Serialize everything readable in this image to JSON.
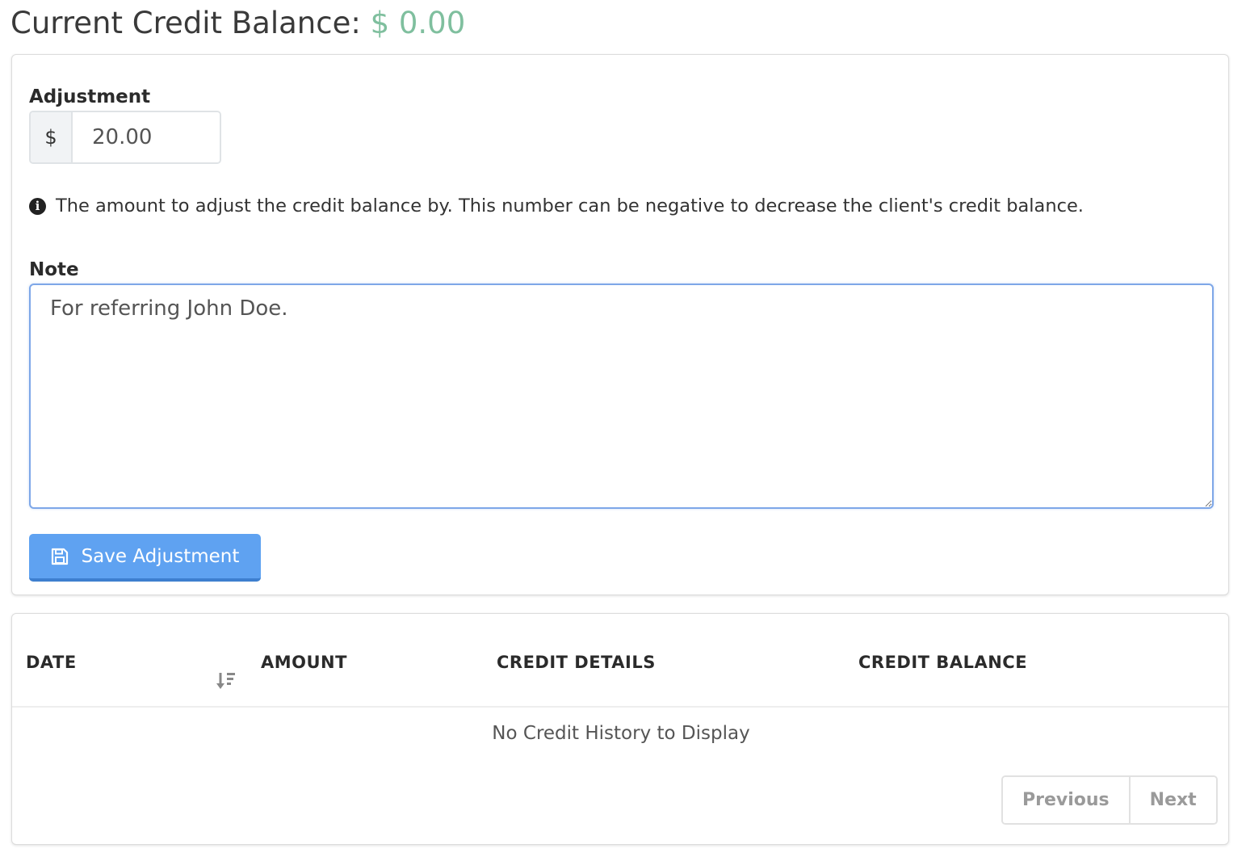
{
  "header": {
    "label": "Current Credit Balance:",
    "value": "$ 0.00",
    "value_color": "#7fbf9e"
  },
  "form": {
    "adjustment_label": "Adjustment",
    "currency_symbol": "$",
    "adjustment_value": "20.00",
    "help_icon": "info-circle-icon",
    "help_text": "The amount to adjust the credit balance by. This number can be negative to decrease the client's credit balance.",
    "note_label": "Note",
    "note_value": "For referring John Doe.",
    "save_icon": "floppy-disk-icon",
    "save_label": "Save Adjustment",
    "button_color": "#5fa2f1"
  },
  "table": {
    "columns": [
      "DATE",
      "AMOUNT",
      "CREDIT DETAILS",
      "CREDIT BALANCE"
    ],
    "sort_icon": "sort-descending-icon",
    "empty_message": "No Credit History to Display",
    "pagination": {
      "previous_label": "Previous",
      "next_label": "Next"
    }
  }
}
